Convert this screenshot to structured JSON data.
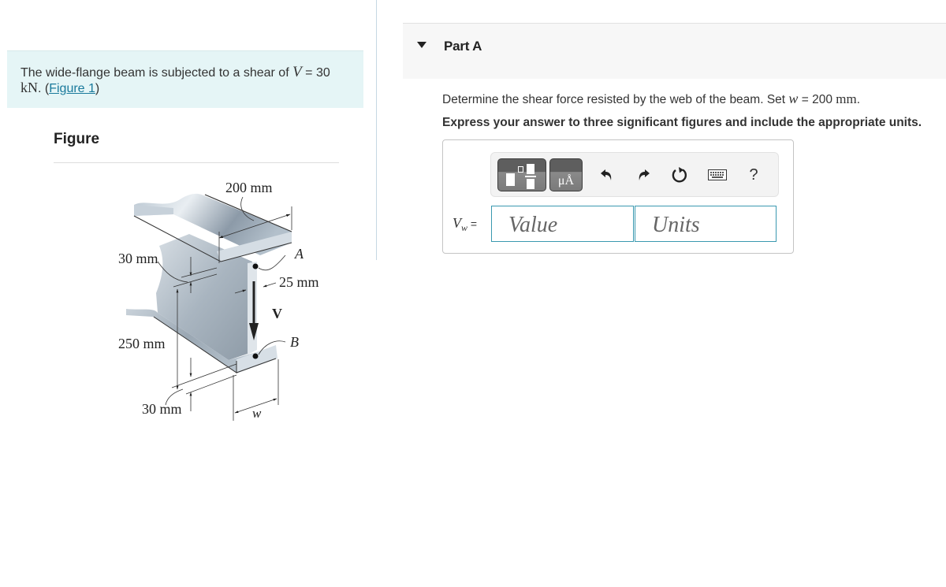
{
  "intro": {
    "text_before": "The wide-flange beam is subjected to a shear of ",
    "variable": "V",
    "equals": " = 30",
    "unit": "kN",
    "text_after_unit": ". (",
    "figure_link": "Figure 1",
    "close_paren": ")"
  },
  "figure": {
    "title": "Figure",
    "labels": {
      "flange_width": "200 mm",
      "top_flange_thickness": "30 mm",
      "web_thickness": "25 mm",
      "web_height": "250 mm",
      "bottom_flange_thickness": "30 mm",
      "width_var": "w",
      "point_a": "A",
      "point_b": "B",
      "shear": "V"
    }
  },
  "part": {
    "title": "Part A",
    "question_before": "Determine the shear force resisted by the web of the beam. Set ",
    "question_var": "w",
    "question_equals": " = 200 ",
    "question_unit": "mm",
    "question_after": ".",
    "instruction": "Express your answer to three significant figures and include the appropriate units."
  },
  "toolbar": {
    "templates_icon": "templates-icon",
    "units_label": "μÅ",
    "undo_icon": "undo-icon",
    "redo_icon": "redo-icon",
    "reset_icon": "reset-icon",
    "keyboard_icon": "keyboard-icon",
    "help_label": "?"
  },
  "answer": {
    "var": "V",
    "sub": "w",
    "equals": " =",
    "value_placeholder": "Value",
    "units_placeholder": "Units",
    "value": "",
    "units": ""
  },
  "colors": {
    "intro_bg": "#e5f5f6",
    "link": "#1a7a9c",
    "field_border": "#3a99b0",
    "part_header_bg": "#f7f7f7"
  }
}
